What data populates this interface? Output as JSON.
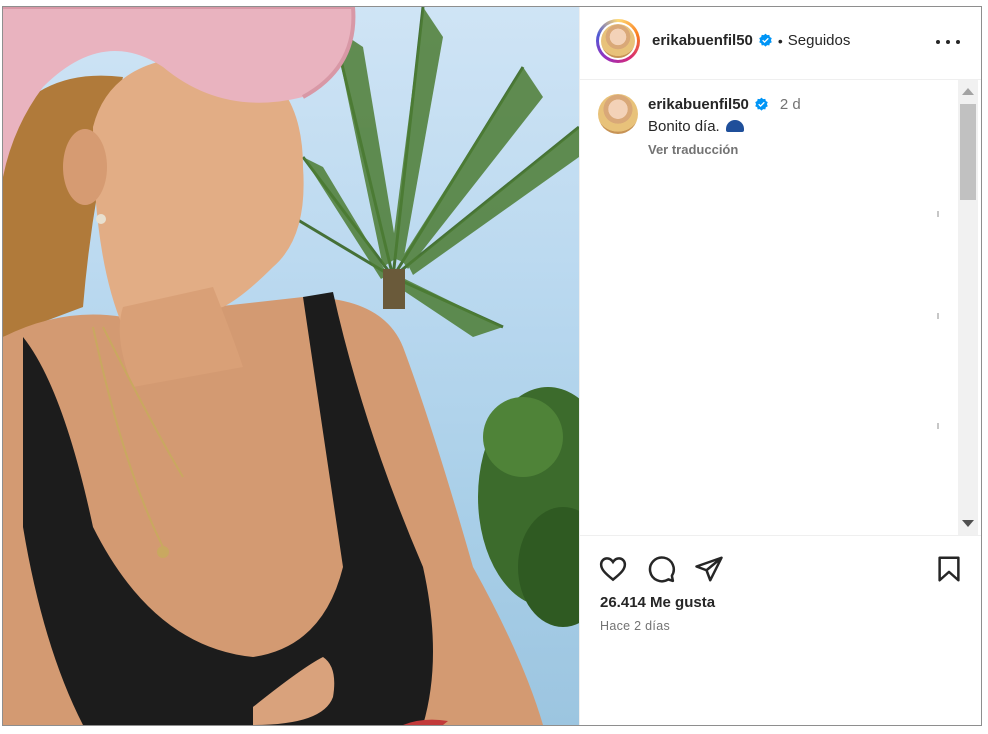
{
  "post": {
    "username": "erikabuenfil50",
    "follow_status": "Seguidos",
    "separator": "•",
    "caption": {
      "username": "erikabuenfil50",
      "time": "2 d",
      "text": "Bonito día.",
      "translate_label": "Ver traducción"
    },
    "likes": "26.414 Me gusta",
    "posted_ago": "Hace 2 días"
  },
  "colors": {
    "verified": "#0095f6",
    "text_primary": "#262626",
    "text_secondary": "#737373"
  },
  "icons": {
    "like": "heart-icon",
    "comment": "comment-icon",
    "share": "paper-plane-icon",
    "save": "bookmark-icon",
    "more": "more-options-icon",
    "verified": "verified-badge-icon"
  }
}
